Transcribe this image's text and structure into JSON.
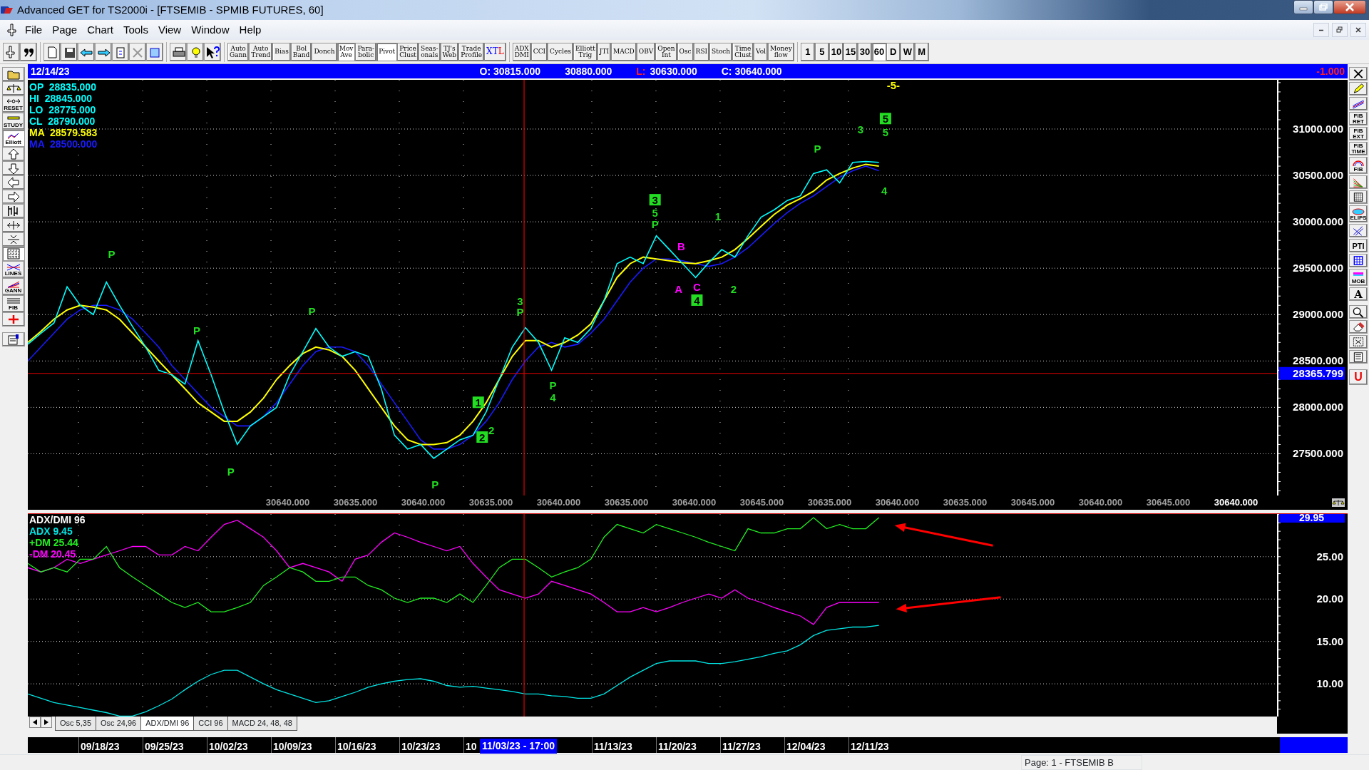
{
  "window": {
    "title": "Advanced GET for TS2000i - [FTSEMIB - SPMIB FUTURES, 60]"
  },
  "menu": [
    "File",
    "Page",
    "Chart",
    "Tools",
    "View",
    "Window",
    "Help"
  ],
  "toolbar": {
    "studies": [
      {
        "label": "Auto\nGann",
        "pressed": false
      },
      {
        "label": "Auto\nTrend",
        "pressed": false
      },
      {
        "label": "Bias",
        "pressed": false
      },
      {
        "label": "Bol\nBand",
        "pressed": false
      },
      {
        "label": "Donch",
        "pressed": false
      },
      {
        "label": "Mov\nAve",
        "pressed": true
      },
      {
        "label": "Para-\nbolic",
        "pressed": false
      },
      {
        "label": "Pivot",
        "pressed": true
      },
      {
        "label": "Price\nClust",
        "pressed": false
      },
      {
        "label": "Seas-\nonals",
        "pressed": false
      },
      {
        "label": "TJ's\nWeb",
        "pressed": false
      },
      {
        "label": "Trade\nProfile",
        "pressed": false
      },
      {
        "label": "XTL",
        "pressed": false,
        "kind": "colored"
      }
    ],
    "indicators": [
      {
        "label": "ADX\nDMI",
        "pressed": false
      },
      {
        "label": "CCI",
        "pressed": false
      },
      {
        "label": "Cycles",
        "pressed": false
      },
      {
        "label": "Elliott\nTrig",
        "pressed": false
      },
      {
        "label": "JTI",
        "pressed": false
      },
      {
        "label": "MACD",
        "pressed": false
      },
      {
        "label": "OBV",
        "pressed": false
      },
      {
        "label": "Open\nInt",
        "pressed": false
      },
      {
        "label": "Osc",
        "pressed": false
      },
      {
        "label": "RSI",
        "pressed": false
      },
      {
        "label": "Stoch",
        "pressed": false
      },
      {
        "label": "Time\nClust",
        "pressed": false
      },
      {
        "label": "Vol",
        "pressed": false
      },
      {
        "label": "Money\nflow",
        "pressed": false
      }
    ],
    "intervals": [
      {
        "label": "1",
        "selected": false
      },
      {
        "label": "5",
        "selected": false
      },
      {
        "label": "10",
        "selected": false
      },
      {
        "label": "15",
        "selected": false
      },
      {
        "label": "30",
        "selected": false
      },
      {
        "label": "60",
        "selected": true
      },
      {
        "label": "D",
        "selected": false
      },
      {
        "label": "W",
        "selected": false
      },
      {
        "label": "M",
        "selected": false
      }
    ]
  },
  "left_toolbar": [
    {
      "pressed": false
    },
    {
      "pressed": false
    },
    {
      "label": "RESET",
      "pressed": false
    },
    {
      "label": "STUDY",
      "pressed": false
    },
    {
      "label": "Elliott",
      "pressed": true
    },
    {
      "pressed": false
    },
    {
      "pressed": false
    },
    {
      "pressed": false
    },
    {
      "pressed": false
    },
    {
      "pressed": false
    },
    {
      "pressed": false
    },
    {
      "pressed": false
    },
    {
      "pressed": true
    },
    {
      "label": "LINES",
      "pressed": false
    },
    {
      "label": "GANN",
      "pressed": false
    },
    {
      "label": "FIB",
      "pressed": false
    },
    {
      "pressed": false
    },
    {
      "pressed": false
    }
  ],
  "right_toolbar_labels": [
    "FIB\nRET",
    "FIB\nEXT",
    "FIB\nTIME",
    "FIB",
    "ELIPS",
    "PTI",
    "MOB",
    "A",
    "U"
  ],
  "info_bar": {
    "date": "12/14/23",
    "items": [
      {
        "text": "O: 30815.000",
        "kind": "value"
      },
      {
        "text": "30880.000",
        "kind": "value"
      },
      {
        "text": "L:",
        "kind": "label"
      },
      {
        "text": "30630.000",
        "kind": "value"
      },
      {
        "text": "C: 30640.000",
        "kind": "value"
      }
    ],
    "change": "-1.000"
  },
  "price_chart": {
    "legend": [
      {
        "label": "OP",
        "value": "28835.000"
      },
      {
        "label": "HI",
        "value": "28845.000"
      },
      {
        "label": "LO",
        "value": "28775.000"
      }
    ],
    "series_values": [
      "28790.000",
      "28579.583",
      "28500.000"
    ],
    "chart_data": {
      "type": "line",
      "grid": true,
      "ylim": [
        27050,
        31530
      ],
      "ref_lines": [
        {
          "axis": "y",
          "value": 28365.799,
          "label": "28365.799"
        }
      ],
      "yticks": [
        {
          "value": 27500,
          "label": "27500.000"
        },
        {
          "value": 28000,
          "label": "28000.000"
        },
        {
          "value": 28500,
          "label": "28500.000"
        },
        {
          "value": 29000,
          "label": "29000.000"
        },
        {
          "value": 29500,
          "label": "29500.000"
        },
        {
          "value": 30000,
          "label": "30000.000"
        },
        {
          "value": 30500,
          "label": "30500.000"
        },
        {
          "value": 31000,
          "label": "31000.000"
        }
      ],
      "series": [
        {
          "name": "CL",
          "color": "#00ffff",
          "values": [
            28680,
            28800,
            28910,
            29300,
            29100,
            29000,
            29350,
            29100,
            28870,
            28650,
            28400,
            28350,
            28250,
            28720,
            28350,
            27950,
            27600,
            27800,
            27900,
            28000,
            28350,
            28600,
            28850,
            28650,
            28550,
            28600,
            28550,
            28200,
            27700,
            27550,
            27600,
            27450,
            27550,
            27650,
            27700,
            27950,
            28300,
            28650,
            28860,
            28700,
            28400,
            28750,
            28700,
            28850,
            29150,
            29550,
            29620,
            29550,
            29850,
            29700,
            29550,
            29400,
            29560,
            29700,
            29620,
            29850,
            30050,
            30130,
            30230,
            30280,
            30520,
            30560,
            30420,
            30640,
            30650,
            30640
          ]
        },
        {
          "name": "MA",
          "color": "#ffff00",
          "values": [
            28700,
            28820,
            28950,
            29050,
            29100,
            29080,
            29050,
            28950,
            28800,
            28650,
            28500,
            28350,
            28200,
            28050,
            27950,
            27850,
            27850,
            27950,
            28100,
            28300,
            28450,
            28580,
            28650,
            28620,
            28550,
            28400,
            28200,
            28000,
            27800,
            27650,
            27600,
            27600,
            27620,
            27700,
            27850,
            28050,
            28300,
            28550,
            28720,
            28720,
            28650,
            28700,
            28780,
            28900,
            29150,
            29400,
            29550,
            29620,
            29600,
            29580,
            29560,
            29550,
            29580,
            29620,
            29700,
            29820,
            29950,
            30080,
            30180,
            30250,
            30330,
            30450,
            30520,
            30580,
            30620,
            30600
          ]
        },
        {
          "name": "MA",
          "color": "#1a1aff",
          "values": [
            28500,
            28650,
            28800,
            28950,
            29050,
            29100,
            29100,
            29050,
            28950,
            28800,
            28650,
            28450,
            28300,
            28150,
            28000,
            27900,
            27800,
            27800,
            27900,
            28050,
            28250,
            28450,
            28600,
            28650,
            28650,
            28600,
            28450,
            28250,
            28050,
            27850,
            27650,
            27550,
            27550,
            27600,
            27700,
            27850,
            28050,
            28300,
            28500,
            28650,
            28700,
            28650,
            28680,
            28800,
            28950,
            29150,
            29350,
            29500,
            29600,
            29600,
            29580,
            29550,
            29520,
            29550,
            29620,
            29720,
            29850,
            29980,
            30100,
            30200,
            30280,
            30380,
            30480,
            30550,
            30600,
            30550
          ]
        }
      ]
    },
    "wave_labels": [
      {
        "kind": "text",
        "text": "P",
        "color": "#22dd22"
      },
      {
        "kind": "text",
        "text": "P",
        "color": "#22dd22"
      },
      {
        "kind": "text",
        "text": "P",
        "color": "#22dd22"
      },
      {
        "kind": "text",
        "text": "P",
        "color": "#22dd22"
      },
      {
        "kind": "text",
        "text": "P",
        "color": "#22dd22"
      },
      {
        "kind": "box",
        "text": "1",
        "color": "#22dd22"
      },
      {
        "kind": "text",
        "text": "2",
        "color": "#22dd22"
      },
      {
        "kind": "box",
        "text": "2",
        "color": "#22dd22"
      },
      {
        "kind": "text",
        "text": "3",
        "color": "#22dd22"
      },
      {
        "kind": "text",
        "text": "P",
        "color": "#22dd22"
      },
      {
        "kind": "text",
        "text": "P",
        "color": "#22dd22"
      },
      {
        "kind": "text",
        "text": "4",
        "color": "#22dd22"
      },
      {
        "kind": "box",
        "text": "3",
        "color": "#22dd22"
      },
      {
        "kind": "text",
        "text": "5",
        "color": "#22dd22"
      },
      {
        "kind": "text",
        "text": "P",
        "color": "#22dd22"
      },
      {
        "kind": "text",
        "text": "B",
        "color": "#ff00ff"
      },
      {
        "kind": "text",
        "text": "A",
        "color": "#ff00ff"
      },
      {
        "kind": "text",
        "text": "C",
        "color": "#ff00ff"
      },
      {
        "kind": "box",
        "text": "4",
        "color": "#22dd22"
      },
      {
        "kind": "text",
        "text": "1",
        "color": "#22dd22"
      },
      {
        "kind": "text",
        "text": "2",
        "color": "#22dd22"
      },
      {
        "kind": "text",
        "text": "P",
        "color": "#22dd22"
      },
      {
        "kind": "text",
        "text": "3",
        "color": "#22dd22"
      },
      {
        "kind": "box",
        "text": "5",
        "color": "#22dd22"
      },
      {
        "kind": "text",
        "text": "5",
        "color": "#22dd22"
      },
      {
        "kind": "text",
        "text": "4",
        "color": "#22dd22"
      },
      {
        "kind": "text",
        "text": "-5-",
        "color": "#ffff00"
      }
    ],
    "bottom_labels": [
      {
        "text": "30640.000",
        "highlighted": false
      },
      {
        "text": "30635.000",
        "highlighted": false
      },
      {
        "text": "30640.000",
        "highlighted": false
      },
      {
        "text": "30635.000",
        "highlighted": false
      },
      {
        "text": "30640.000",
        "highlighted": false
      },
      {
        "text": "30635.000",
        "highlighted": false
      },
      {
        "text": "30640.000",
        "highlighted": false
      },
      {
        "text": "30645.000",
        "highlighted": false
      },
      {
        "text": "30635.000",
        "highlighted": false
      },
      {
        "text": "30640.000",
        "highlighted": false
      },
      {
        "text": "30635.000",
        "highlighted": false
      },
      {
        "text": "30645.000",
        "highlighted": false
      },
      {
        "text": "30640.000",
        "highlighted": false
      },
      {
        "text": "30645.000",
        "highlighted": false
      },
      {
        "text": "30640.000",
        "highlighted": true
      }
    ]
  },
  "indicator_chart": {
    "title": "ADX/DMI 96",
    "series_values": [
      "9.45",
      "25.44",
      "20.45"
    ],
    "value_tag": "29.95",
    "chart_data": {
      "type": "line",
      "grid": true,
      "ylim": [
        6.14,
        30.03
      ],
      "yticks": [
        {
          "value": 10,
          "label": "10.00"
        },
        {
          "value": 15,
          "label": "15.00"
        },
        {
          "value": 20,
          "label": "20.00"
        },
        {
          "value": 25,
          "label": "25.00"
        }
      ],
      "series": [
        {
          "name": "ADX",
          "color": "#00e5e5",
          "values": [
            8.8,
            8.3,
            7.8,
            7.5,
            7.2,
            6.9,
            6.6,
            6.2,
            6.2,
            6.7,
            7.4,
            8.2,
            9.3,
            10.3,
            11.1,
            11.6,
            11.6,
            10.8,
            10.0,
            9.3,
            8.8,
            8.3,
            7.8,
            8.0,
            8.5,
            9.0,
            9.6,
            10.0,
            10.3,
            10.5,
            10.6,
            10.3,
            9.8,
            9.6,
            9.7,
            9.5,
            9.3,
            9.1,
            8.8,
            8.8,
            8.6,
            8.5,
            8.3,
            8.3,
            8.8,
            9.8,
            10.8,
            11.6,
            12.4,
            12.7,
            12.7,
            12.7,
            12.4,
            12.4,
            12.6,
            12.9,
            13.2,
            13.6,
            13.9,
            14.6,
            15.7,
            16.3,
            16.5,
            16.7,
            16.7,
            16.9
          ]
        },
        {
          "name": "+DM",
          "color": "#22ee22",
          "values": [
            24.2,
            23.2,
            23.7,
            23.2,
            24.7,
            24.7,
            26.2,
            23.7,
            22.6,
            21.6,
            20.6,
            19.6,
            19.0,
            19.6,
            18.5,
            18.5,
            19.0,
            19.6,
            21.6,
            22.6,
            23.7,
            23.2,
            22.1,
            22.1,
            22.6,
            22.6,
            21.6,
            21.1,
            20.1,
            19.6,
            20.1,
            20.1,
            19.6,
            20.6,
            19.6,
            21.6,
            23.7,
            24.7,
            24.7,
            23.7,
            22.6,
            23.2,
            23.7,
            24.7,
            27.3,
            28.8,
            28.3,
            27.8,
            28.8,
            28.3,
            27.8,
            27.3,
            26.7,
            26.2,
            25.7,
            28.3,
            27.8,
            27.8,
            28.3,
            28.3,
            29.6,
            28.3,
            28.8,
            28.3,
            28.3,
            29.6
          ]
        },
        {
          "name": "-DM",
          "color": "#ff00ff",
          "values": [
            23.7,
            23.2,
            23.7,
            24.7,
            24.2,
            24.7,
            25.2,
            25.7,
            26.2,
            26.2,
            25.2,
            25.2,
            26.2,
            25.7,
            27.3,
            28.8,
            29.3,
            28.3,
            27.3,
            25.7,
            23.7,
            24.2,
            23.7,
            23.2,
            22.1,
            24.7,
            25.2,
            26.7,
            27.8,
            27.3,
            26.7,
            26.2,
            25.7,
            26.2,
            24.2,
            22.6,
            21.1,
            20.6,
            20.1,
            20.6,
            22.1,
            21.6,
            21.1,
            20.6,
            19.6,
            18.5,
            18.5,
            19.0,
            18.5,
            19.0,
            19.6,
            20.1,
            20.6,
            20.1,
            21.1,
            20.1,
            19.6,
            19.0,
            18.5,
            18.0,
            17.0,
            19.0,
            19.6,
            19.6,
            19.6,
            19.6
          ]
        }
      ]
    }
  },
  "indicator_tabs": [
    {
      "label": "Osc 5,35",
      "selected": false
    },
    {
      "label": "Osc 24,96",
      "selected": false
    },
    {
      "label": "ADX/DMI 96",
      "selected": true
    },
    {
      "label": "CCI 96",
      "selected": false
    },
    {
      "label": "MACD 24, 48, 48",
      "selected": false
    }
  ],
  "date_axis": {
    "labels": [
      "09/18/23",
      "09/25/23",
      "10/02/23",
      "10/09/23",
      "10/16/23",
      "10/23/23",
      "10",
      "11/13/23",
      "11/20/23",
      "11/27/23",
      "12/04/23",
      "12/11/23"
    ],
    "cursor_label": "11/03/23 - 17:00"
  },
  "status_bar": "Page: 1 - FTSEMIB B"
}
